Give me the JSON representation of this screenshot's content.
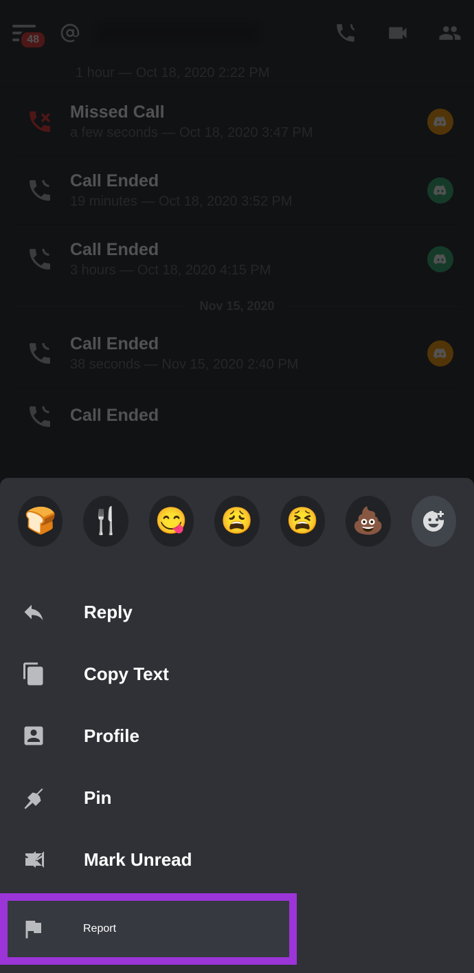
{
  "header": {
    "badge_count": "48"
  },
  "calls": {
    "partial_top": "1 hour — Oct 18, 2020 2:22 PM",
    "items": [
      {
        "title": "Missed Call",
        "meta": "a few seconds — Oct 18, 2020 3:47 PM",
        "missed": true,
        "avatar": "yellow"
      },
      {
        "title": "Call Ended",
        "meta": "19 minutes — Oct 18, 2020 3:52 PM",
        "missed": false,
        "avatar": "green"
      },
      {
        "title": "Call Ended",
        "meta": "3 hours — Oct 18, 2020 4:15 PM",
        "missed": false,
        "avatar": "green"
      }
    ],
    "divider": "Nov 15, 2020",
    "after_divider": [
      {
        "title": "Call Ended",
        "meta": "38 seconds — Nov 15, 2020 2:40 PM",
        "missed": false,
        "avatar": "yellow"
      },
      {
        "title": "Call Ended",
        "meta": "",
        "missed": false,
        "avatar": "green"
      }
    ]
  },
  "emojis": [
    "🍞",
    "🍴",
    "😋",
    "😩",
    "😫",
    "💩"
  ],
  "menu": {
    "reply": "Reply",
    "copy_text": "Copy Text",
    "profile": "Profile",
    "pin": "Pin",
    "mark_unread": "Mark Unread",
    "report": "Report"
  },
  "colors": {
    "highlight": "#9b35d8",
    "missed": "#f04747",
    "normal_icon": "#b9bbbe"
  }
}
